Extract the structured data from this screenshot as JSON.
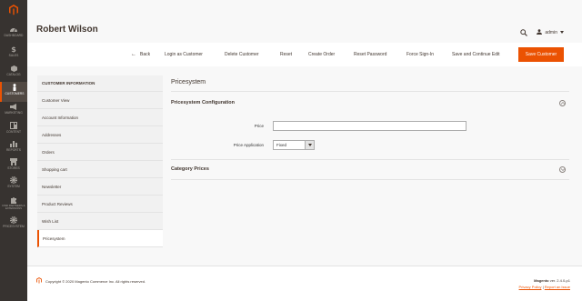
{
  "sidebar": {
    "items": [
      {
        "label": "Dashboard",
        "icon": "dashboard-icon"
      },
      {
        "label": "Sales",
        "icon": "dollar-icon"
      },
      {
        "label": "Catalog",
        "icon": "cube-icon"
      },
      {
        "label": "Customers",
        "icon": "person-icon"
      },
      {
        "label": "Marketing",
        "icon": "megaphone-icon"
      },
      {
        "label": "Content",
        "icon": "layout-icon"
      },
      {
        "label": "Reports",
        "icon": "bar-chart-icon"
      },
      {
        "label": "Stores",
        "icon": "store-icon"
      },
      {
        "label": "System",
        "icon": "gear-icon"
      },
      {
        "label": "Find Partners & Extensions",
        "icon": "puzzle-icon"
      },
      {
        "label": "Pricesystem",
        "icon": "gear-icon"
      }
    ],
    "active": "Customers"
  },
  "header": {
    "title": "Robert Wilson",
    "user": "admin"
  },
  "actions": {
    "back": "Back",
    "login_as_customer": "Login as Customer",
    "delete_customer": "Delete Customer",
    "reset": "Reset",
    "create_order": "Create Order",
    "reset_password": "Reset Password",
    "force_sign_in": "Force Sign-In",
    "save_and_continue": "Save and Continue Edit",
    "save_customer": "Save Customer"
  },
  "tabs": {
    "title": "CUSTOMER INFORMATION",
    "items": [
      "Customer View",
      "Account Information",
      "Addresses",
      "Orders",
      "Shopping cart",
      "Newsletter",
      "Product Reviews",
      "Wish List",
      "Pricesystem"
    ],
    "active": "Pricesystem"
  },
  "main": {
    "section_title": "Pricesystem",
    "fieldset_title": "Pricesystem Configuration",
    "price_label": "Price",
    "price_value": "",
    "price_application_label": "Price Application",
    "price_application_value": "Fixed",
    "category_prices_title": "Category Prices"
  },
  "footer": {
    "copyright": "Copyright © 2020 Magento Commerce Inc. All rights reserved.",
    "brand": "Magento",
    "version": "ver. 2.4.0-p1",
    "privacy_policy": "Privacy Policy",
    "separator": "|",
    "report_issue": "Report an Issue"
  },
  "colors": {
    "accent": "#eb5202",
    "sidebar_bg": "#373330",
    "sidebar_active_bg": "#514943"
  }
}
